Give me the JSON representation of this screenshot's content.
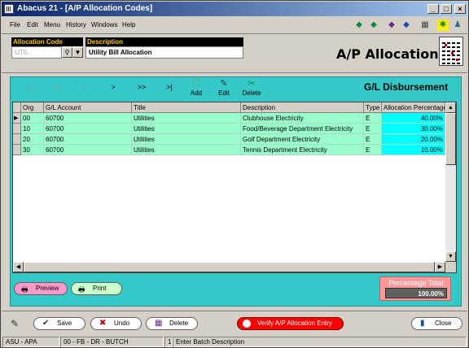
{
  "window": {
    "app_name": "Abacus 21",
    "title": "Abacus 21 - [A/P Allocation Codes]",
    "minimize": "_",
    "maximize": "□",
    "close": "×"
  },
  "menu": [
    "File",
    "Edit",
    "Menu",
    "History",
    "Windows",
    "Help"
  ],
  "toolbar": {
    "icons": [
      "back-arrow-icon",
      "forward-arrow-icon",
      "book-icon",
      "help-icon",
      "calculator-icon",
      "run-icon",
      "user-icon"
    ]
  },
  "header": {
    "allocation_code_label": "Allocation Code",
    "allocation_code_value": "UTIL",
    "description_label": "Description",
    "description_value": "Utility Bill Allocation",
    "page_title": "A/P Allocations"
  },
  "panel": {
    "title": "G/L Disbursement",
    "nav_first": "|<",
    "nav_prev_page": "<<",
    "nav_prev": "<",
    "nav_next": ">",
    "nav_next_page": ">>",
    "nav_last": ">|",
    "add_label": "Add",
    "edit_label": "Edit",
    "delete_label": "Delete"
  },
  "grid": {
    "columns": [
      "Org",
      "G/L Account",
      "Title",
      "Description",
      "Type",
      "Allocation Percentage"
    ],
    "rows": [
      {
        "org": "00",
        "account": "60700",
        "title": "Utilities",
        "description": "Clubhouse Electricity",
        "type": "E",
        "pct": "40.00%"
      },
      {
        "org": "10",
        "account": "60700",
        "title": "Utilities",
        "description": "Food/Beverage Department Electricity",
        "type": "E",
        "pct": "30.00%"
      },
      {
        "org": "20",
        "account": "60700",
        "title": "Utilities",
        "description": "Golf Department Electricity",
        "type": "E",
        "pct": "20.00%"
      },
      {
        "org": "30",
        "account": "60700",
        "title": "Utilities",
        "description": "Tennis Department Electricity",
        "type": "E",
        "pct": "10.00%"
      }
    ]
  },
  "footer": {
    "preview_label": "Preview",
    "print_label": "Print",
    "percentage_total_label": "Percentage Total",
    "percentage_total_value": "100.00%",
    "save_label": "Save",
    "undo_label": "Undo",
    "delete_label": "Delete",
    "verify_label": "Verify A/P Allocation Entry",
    "close_label": "Close"
  },
  "status": {
    "company": "ASU - APA",
    "session": "00 - FB - DR - BUTCH",
    "count": "1",
    "message": "Enter Batch Description"
  },
  "colors": {
    "title_bar": "#0a246a",
    "panel_teal": "#35c8c8",
    "row_green": "#99ffcc",
    "pct_cyan": "#00ffff",
    "verify_red": "#ff0000"
  }
}
